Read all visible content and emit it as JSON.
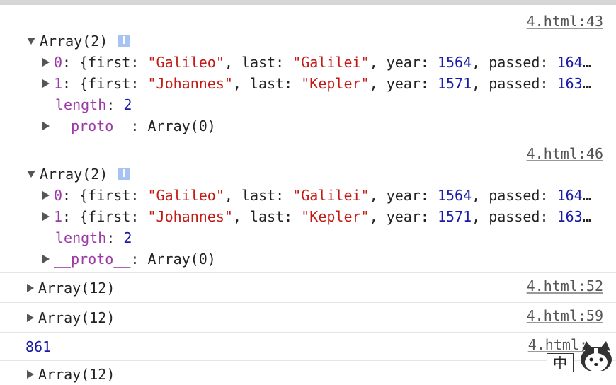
{
  "entries": [
    {
      "source": "4.html:43",
      "header": "Array(2)",
      "info_icon": "i",
      "items": [
        {
          "index": "0",
          "first": "\"Galileo\"",
          "last": "\"Galilei\"",
          "year": "1564",
          "passed_prefix": "164"
        },
        {
          "index": "1",
          "first": "\"Johannes\"",
          "last": "\"Kepler\"",
          "year": "1571",
          "passed_prefix": "163"
        }
      ],
      "length_key": "length",
      "length_value": "2",
      "proto_key": "__proto__",
      "proto_value": "Array(0)"
    },
    {
      "source": "4.html:46",
      "header": "Array(2)",
      "info_icon": "i",
      "items": [
        {
          "index": "0",
          "first": "\"Galileo\"",
          "last": "\"Galilei\"",
          "year": "1564",
          "passed_prefix": "164"
        },
        {
          "index": "1",
          "first": "\"Johannes\"",
          "last": "\"Kepler\"",
          "year": "1571",
          "passed_prefix": "163"
        }
      ],
      "length_key": "length",
      "length_value": "2",
      "proto_key": "__proto__",
      "proto_value": "Array(0)"
    },
    {
      "source": "4.html:52",
      "header": "Array(12)"
    },
    {
      "source": "4.html:59",
      "header": "Array(12)"
    },
    {
      "source": "4.html:",
      "value": "861"
    },
    {
      "header": "Array(12)"
    }
  ],
  "labels": {
    "first": "first",
    "last": "last",
    "year": "year",
    "passed": "passed",
    "ellipsis": "…"
  },
  "ime_label": "中",
  "colors": {
    "key": "#9b3aa6",
    "string": "#c41a16",
    "number": "#1a1aa6"
  }
}
